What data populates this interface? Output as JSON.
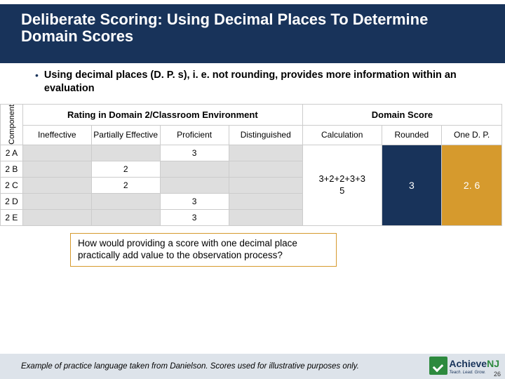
{
  "titlebar": {
    "heading": "Deliberate Scoring: Using Decimal Places To Determine Domain Scores"
  },
  "bullet": {
    "text": "Using decimal places (D. P. s), i. e. not rounding, provides more information within an evaluation"
  },
  "table": {
    "component_label": "Component",
    "rating_header": "Rating in Domain 2/Classroom Environment",
    "domain_header": "Domain Score",
    "subheaders": {
      "ineffective": "Ineffective",
      "partially": "Partially Effective",
      "proficient": "Proficient",
      "distinguished": "Distinguished",
      "calculation": "Calculation",
      "rounded": "Rounded",
      "onedp": "One D. P."
    },
    "rows": [
      "2 A",
      "2 B",
      "2 C",
      "2 D",
      "2 E"
    ],
    "values": {
      "r2A_proficient": "3",
      "r2B_partially": "2",
      "r2C_partially": "2",
      "r2D_proficient": "3",
      "r2E_proficient": "3"
    },
    "calc_top": "3+2+2+3+3",
    "calc_bottom": "5",
    "rounded": "3",
    "onedp": "2. 6"
  },
  "question": {
    "text": "How would providing a score with one decimal place practically add value to the observation process?"
  },
  "footer": {
    "text": "Example of practice language taken from Danielson. Scores used for illustrative purposes only."
  },
  "logo": {
    "brandA": "Achieve",
    "brandB": "NJ",
    "tag": "Teach. Lead. Grow."
  },
  "page": {
    "num": "26"
  }
}
